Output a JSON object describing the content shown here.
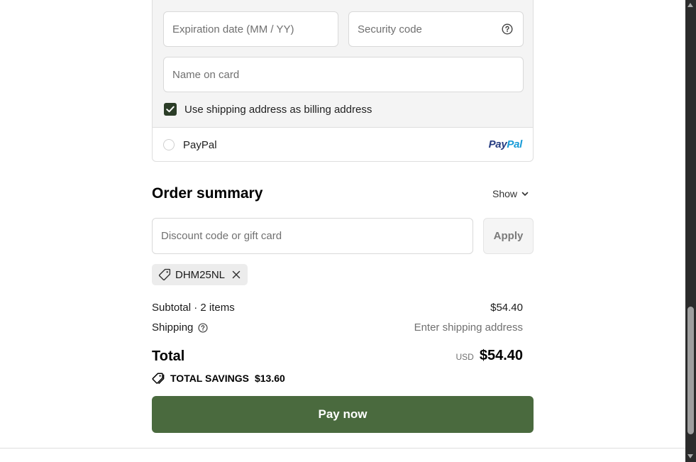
{
  "payment": {
    "expiration_placeholder": "Expiration date (MM / YY)",
    "security_placeholder": "Security code",
    "name_placeholder": "Name on card",
    "billing_checkbox_label": "Use shipping address as billing address",
    "billing_checked": true,
    "paypal_label": "PayPal",
    "paypal_logo_pay": "Pay",
    "paypal_logo_pal": "Pal"
  },
  "summary": {
    "title": "Order summary",
    "show_label": "Show",
    "discount_placeholder": "Discount code or gift card",
    "apply_label": "Apply",
    "applied_code": "DHM25NL",
    "subtotal_label": "Subtotal · 2 items",
    "subtotal_value": "$54.40",
    "shipping_label": "Shipping",
    "shipping_value": "Enter shipping address",
    "total_label": "Total",
    "currency": "USD",
    "total_value": "$54.40",
    "savings_label": "TOTAL SAVINGS",
    "savings_value": "$13.60",
    "pay_label": "Pay now"
  },
  "colors": {
    "primary_button": "#4a6a3e",
    "checkbox": "#2b3d27"
  }
}
